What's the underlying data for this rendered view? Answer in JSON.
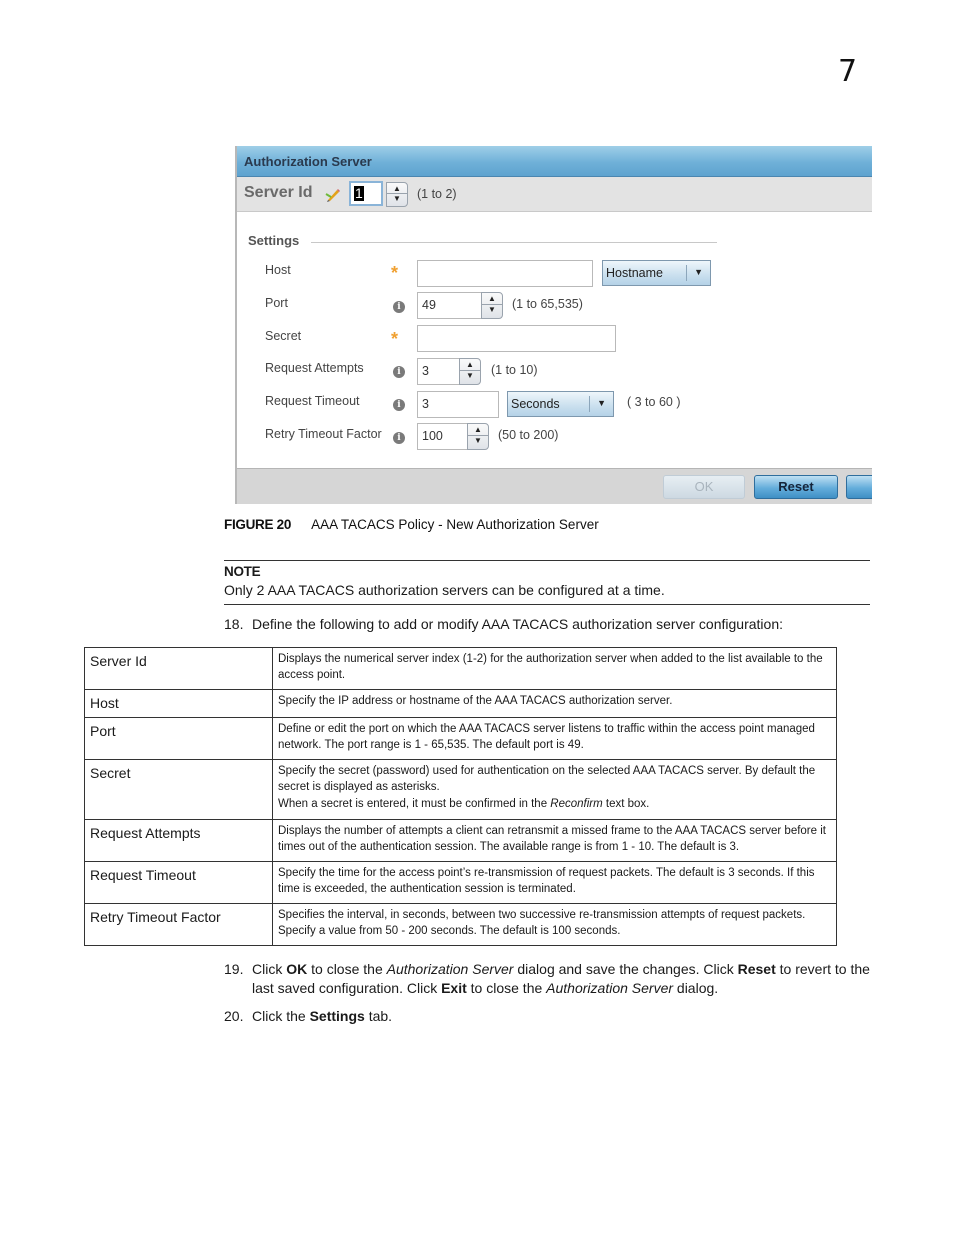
{
  "page": {
    "chapter_number": "7"
  },
  "dialog": {
    "title": "Authorization Server",
    "server_id": {
      "label": "Server Id",
      "value": "1",
      "range": "(1 to 2)"
    },
    "settings_label": "Settings",
    "fields": {
      "host": {
        "label": "Host",
        "value": "",
        "type_select": "Hostname"
      },
      "port": {
        "label": "Port",
        "value": "49",
        "range": "(1 to 65,535)"
      },
      "secret": {
        "label": "Secret",
        "value": ""
      },
      "request_attempts": {
        "label": "Request Attempts",
        "value": "3",
        "range": "(1 to 10)"
      },
      "request_timeout": {
        "label": "Request Timeout",
        "value": "3",
        "unit_select": "Seconds",
        "range": "( 3 to 60 )"
      },
      "retry_timeout_factor": {
        "label": "Retry Timeout Factor",
        "value": "100",
        "range": "(50 to 200)"
      }
    },
    "buttons": {
      "ok": "OK",
      "reset": "Reset",
      "exit": ""
    }
  },
  "figure": {
    "number": "FIGURE 20",
    "caption": "AAA TACACS Policy - New Authorization Server"
  },
  "note": {
    "title": "NOTE",
    "text": "Only 2 AAA TACACS authorization servers can be configured at a time."
  },
  "steps": {
    "s18": {
      "num": "18.",
      "text": "Define the following to add or modify AAA TACACS authorization server configuration:"
    },
    "s19": {
      "num": "19.",
      "t1": "Click ",
      "b1": "OK",
      "t2": " to close the ",
      "i1": "Authorization Server",
      "t3": " dialog and save the changes. Click ",
      "b2": "Reset",
      "t4": " to revert to the last saved configuration. Click ",
      "b3": "Exit",
      "t5": " to close the ",
      "i2": "Authorization Server",
      "t6": " dialog."
    },
    "s20": {
      "num": "20.",
      "t1": "Click the ",
      "b1": "Settings",
      "t2": " tab."
    }
  },
  "table": {
    "rows": [
      {
        "key": "Server Id",
        "desc": [
          "Displays the numerical server index (1-2) for the authorization server when added to the list available to the access point."
        ]
      },
      {
        "key": "Host",
        "desc": [
          "Specify the IP address or hostname of the AAA TACACS authorization server."
        ]
      },
      {
        "key": "Port",
        "desc": [
          "Define or edit the port on which the AAA TACACS server listens to traffic within the access point managed network. The port range is 1 - 65,535. The default port is 49."
        ]
      },
      {
        "key": "Secret",
        "desc": [
          "Specify the secret (password) used for authentication on the selected AAA TACACS server. By default the secret is displayed as asterisks."
        ],
        "desc2": {
          "pre": "When a secret is entered, it must be confirmed in the ",
          "em": "Reconfirm",
          "post": " text box."
        }
      },
      {
        "key": "Request Attempts",
        "desc": [
          "Displays the number of attempts a client can retransmit a missed frame to the AAA TACACS server before it times out of the authentication session. The available range is from 1 - 10. The default is 3."
        ]
      },
      {
        "key": "Request Timeout",
        "desc": [
          "Specify the time for the access point’s re-transmission of request packets. The default is 3 seconds. If this time is exceeded, the authentication session is terminated."
        ]
      },
      {
        "key": "Retry Timeout Factor",
        "desc": [
          "Specifies the interval, in seconds, between two successive re-transmission attempts of request packets. Specify a value from 50 - 200 seconds. The default is 100 seconds."
        ]
      }
    ]
  }
}
